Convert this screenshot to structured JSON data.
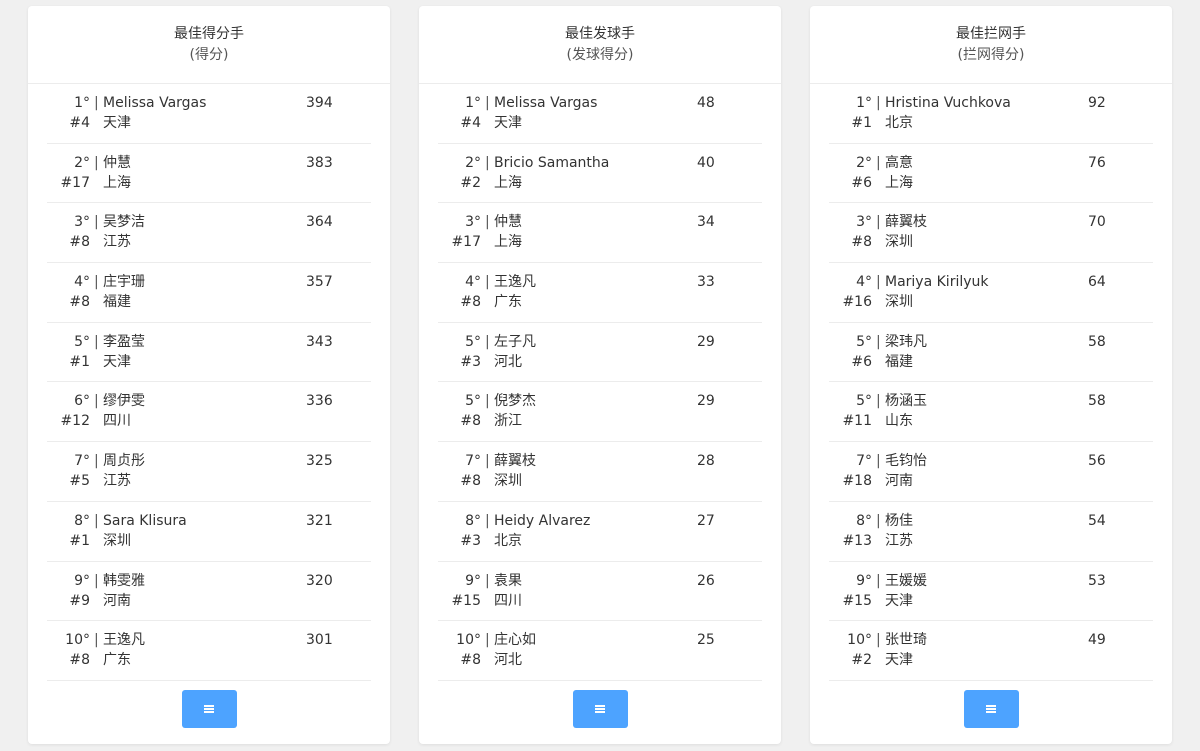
{
  "colors": {
    "button": "#4da3ff",
    "background": "#f0f0f0",
    "card": "#ffffff"
  },
  "menu_button_icon": "menu-icon",
  "cards": [
    {
      "title": "最佳得分手",
      "subtitle": "(得分)",
      "rows": [
        {
          "rank": "1°",
          "seed": "#4",
          "name": "Melissa Vargas",
          "team": "天津",
          "value": "394"
        },
        {
          "rank": "2°",
          "seed": "#17",
          "name": "仲慧",
          "team": "上海",
          "value": "383"
        },
        {
          "rank": "3°",
          "seed": "#8",
          "name": "吴梦洁",
          "team": "江苏",
          "value": "364"
        },
        {
          "rank": "4°",
          "seed": "#8",
          "name": "庄宇珊",
          "team": "福建",
          "value": "357"
        },
        {
          "rank": "5°",
          "seed": "#1",
          "name": "李盈莹",
          "team": "天津",
          "value": "343"
        },
        {
          "rank": "6°",
          "seed": "#12",
          "name": "缪伊雯",
          "team": "四川",
          "value": "336"
        },
        {
          "rank": "7°",
          "seed": "#5",
          "name": "周贞彤",
          "team": "江苏",
          "value": "325"
        },
        {
          "rank": "8°",
          "seed": "#1",
          "name": "Sara Klisura",
          "team": "深圳",
          "value": "321"
        },
        {
          "rank": "9°",
          "seed": "#9",
          "name": "韩雯雅",
          "team": "河南",
          "value": "320"
        },
        {
          "rank": "10°",
          "seed": "#8",
          "name": "王逸凡",
          "team": "广东",
          "value": "301"
        }
      ]
    },
    {
      "title": "最佳发球手",
      "subtitle": "(发球得分)",
      "rows": [
        {
          "rank": "1°",
          "seed": "#4",
          "name": "Melissa Vargas",
          "team": "天津",
          "value": "48"
        },
        {
          "rank": "2°",
          "seed": "#2",
          "name": "Bricio Samantha",
          "team": "上海",
          "value": "40"
        },
        {
          "rank": "3°",
          "seed": "#17",
          "name": "仲慧",
          "team": "上海",
          "value": "34"
        },
        {
          "rank": "4°",
          "seed": "#8",
          "name": "王逸凡",
          "team": "广东",
          "value": "33"
        },
        {
          "rank": "5°",
          "seed": "#3",
          "name": "左子凡",
          "team": "河北",
          "value": "29"
        },
        {
          "rank": "5°",
          "seed": "#8",
          "name": "倪梦杰",
          "team": "浙江",
          "value": "29"
        },
        {
          "rank": "7°",
          "seed": "#8",
          "name": "薛翼枝",
          "team": "深圳",
          "value": "28"
        },
        {
          "rank": "8°",
          "seed": "#3",
          "name": "Heidy Alvarez",
          "team": "北京",
          "value": "27"
        },
        {
          "rank": "9°",
          "seed": "#15",
          "name": "袁果",
          "team": "四川",
          "value": "26"
        },
        {
          "rank": "10°",
          "seed": "#8",
          "name": "庄心如",
          "team": "河北",
          "value": "25"
        }
      ]
    },
    {
      "title": "最佳拦网手",
      "subtitle": "(拦网得分)",
      "rows": [
        {
          "rank": "1°",
          "seed": "#1",
          "name": "Hristina Vuchkova",
          "team": "北京",
          "value": "92"
        },
        {
          "rank": "2°",
          "seed": "#6",
          "name": "高意",
          "team": "上海",
          "value": "76"
        },
        {
          "rank": "3°",
          "seed": "#8",
          "name": "薛翼枝",
          "team": "深圳",
          "value": "70"
        },
        {
          "rank": "4°",
          "seed": "#16",
          "name": "Mariya Kirilyuk",
          "team": "深圳",
          "value": "64"
        },
        {
          "rank": "5°",
          "seed": "#6",
          "name": "梁玮凡",
          "team": "福建",
          "value": "58"
        },
        {
          "rank": "5°",
          "seed": "#11",
          "name": "杨涵玉",
          "team": "山东",
          "value": "58"
        },
        {
          "rank": "7°",
          "seed": "#18",
          "name": "毛钧怡",
          "team": "河南",
          "value": "56"
        },
        {
          "rank": "8°",
          "seed": "#13",
          "name": "杨佳",
          "team": "江苏",
          "value": "54"
        },
        {
          "rank": "9°",
          "seed": "#15",
          "name": "王媛媛",
          "team": "天津",
          "value": "53"
        },
        {
          "rank": "10°",
          "seed": "#2",
          "name": "张世琦",
          "team": "天津",
          "value": "49"
        }
      ]
    }
  ]
}
